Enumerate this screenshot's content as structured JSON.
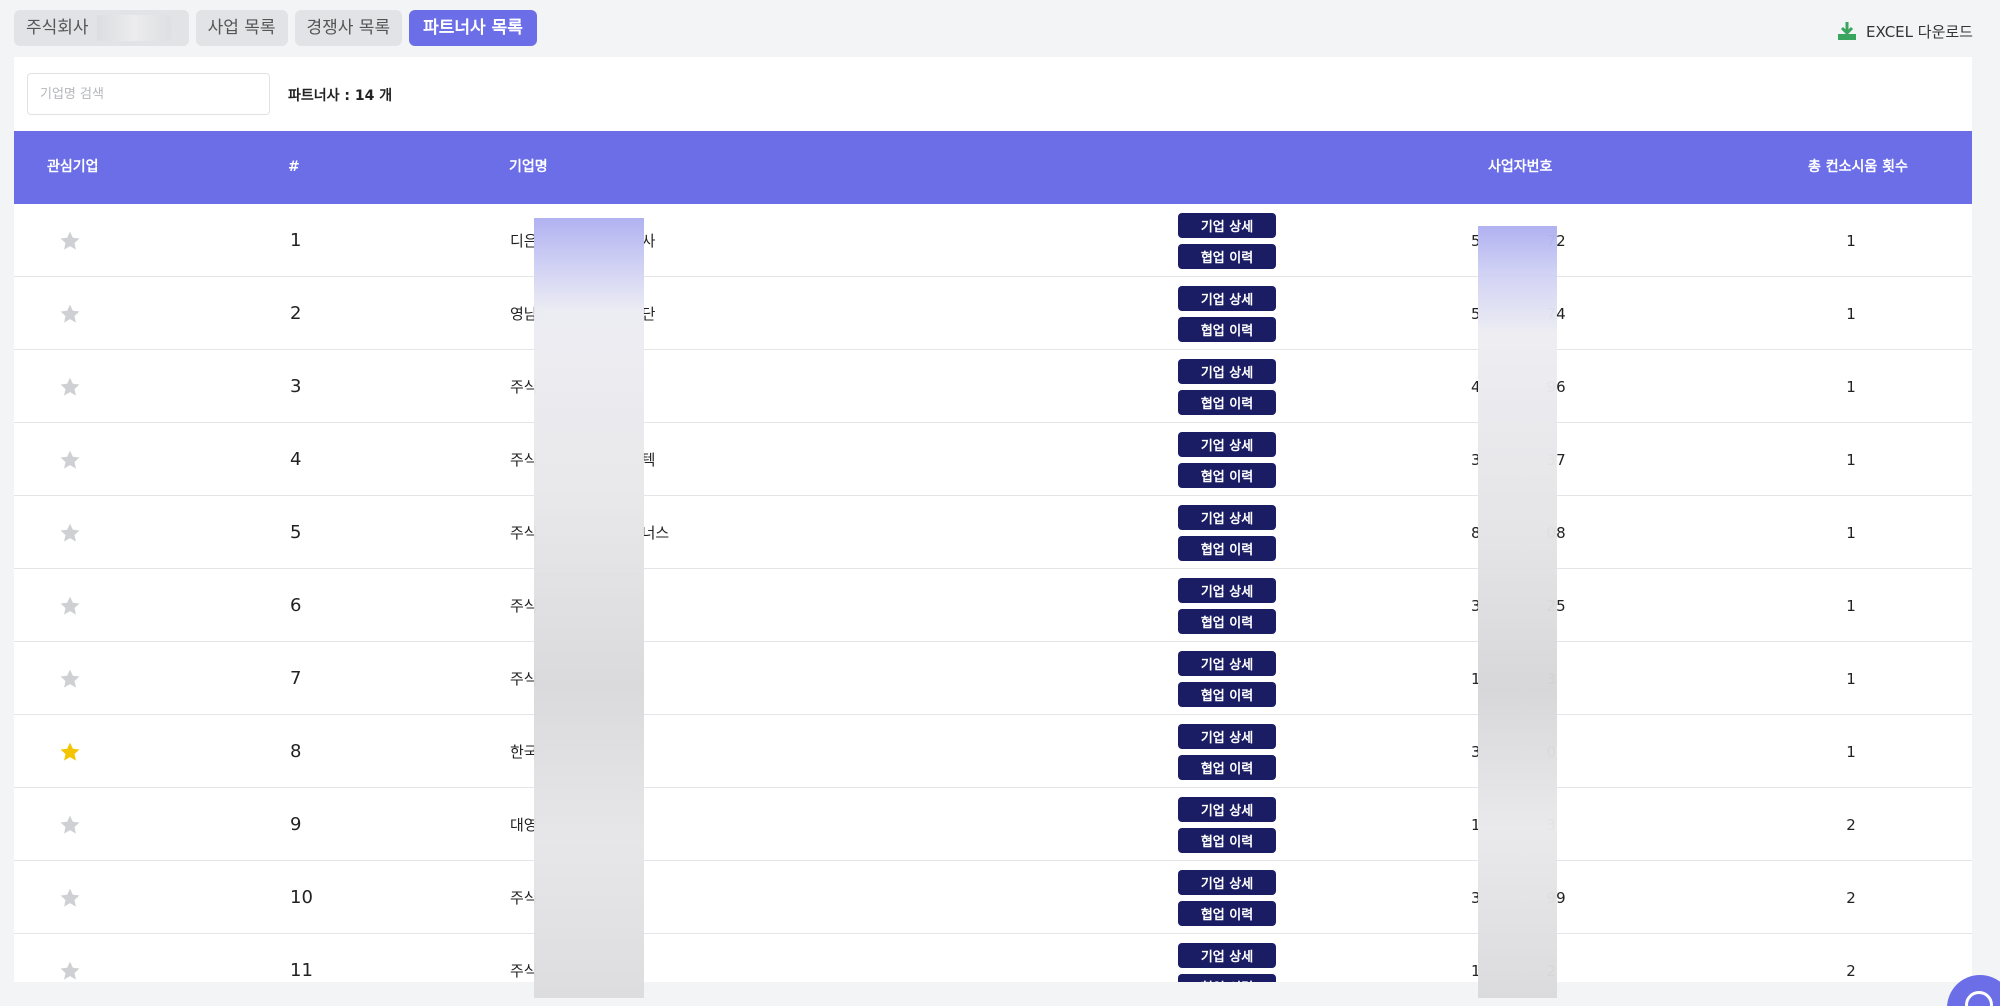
{
  "tabs": [
    {
      "label": "주식회사"
    },
    {
      "label": "사업 목록"
    },
    {
      "label": "경쟁사 목록"
    },
    {
      "label": "파트너사 목록",
      "active": true
    }
  ],
  "excel": {
    "label": "EXCEL 다운로드",
    "icon": "download-icon"
  },
  "search": {
    "placeholder": "기업명 검색",
    "value": ""
  },
  "count_label": "파트너사 : 14 개",
  "table": {
    "headers": {
      "favorite": "관심기업",
      "number": "#",
      "name": "기업명",
      "biz_no": "사업자번호",
      "consult": "총 컨소시움 횟수"
    },
    "buttons": {
      "detail": "기업 상세",
      "history": "협업 이력"
    },
    "rows": [
      {
        "favorite": false,
        "number": "1",
        "name_start": "디은",
        "name_end": "사",
        "biz_start": "5",
        "biz_end": "72",
        "consult": "1"
      },
      {
        "favorite": false,
        "number": "2",
        "name_start": "영남",
        "name_end": "단",
        "biz_start": "5",
        "biz_end": "74",
        "consult": "1"
      },
      {
        "favorite": false,
        "number": "3",
        "name_start": "주식",
        "name_end": "",
        "biz_start": "4",
        "biz_end": "96",
        "consult": "1"
      },
      {
        "favorite": false,
        "number": "4",
        "name_start": "주식",
        "name_end": "텍",
        "biz_start": "3",
        "biz_end": "37",
        "consult": "1"
      },
      {
        "favorite": false,
        "number": "5",
        "name_start": "주식",
        "name_end": "너스",
        "biz_start": "8",
        "biz_end": "08",
        "consult": "1"
      },
      {
        "favorite": false,
        "number": "6",
        "name_start": "주식",
        "name_end": "",
        "biz_start": "3",
        "biz_end": "25",
        "consult": "1"
      },
      {
        "favorite": false,
        "number": "7",
        "name_start": "주식",
        "name_end": "",
        "biz_start": "1",
        "biz_end": "3",
        "consult": "1"
      },
      {
        "favorite": true,
        "number": "8",
        "name_start": "한국",
        "name_end": "",
        "biz_start": "3",
        "biz_end": "0",
        "consult": "1"
      },
      {
        "favorite": false,
        "number": "9",
        "name_start": "대영",
        "name_end": "",
        "biz_start": "1",
        "biz_end": "3",
        "consult": "2"
      },
      {
        "favorite": false,
        "number": "10",
        "name_start": "주식",
        "name_end": "",
        "biz_start": "3",
        "biz_end": "99",
        "consult": "2"
      },
      {
        "favorite": false,
        "number": "11",
        "name_start": "주식",
        "name_end": "",
        "biz_start": "1",
        "biz_end": "2",
        "consult": "2"
      }
    ]
  },
  "colors": {
    "accent": "#6b6ee6",
    "button_dark": "#1a1d63",
    "star_active": "#f5c400",
    "star_inactive": "#cfd0d3",
    "excel_icon": "#3aa55e"
  },
  "icons": {
    "star": "star-icon",
    "chat": "chat-icon"
  }
}
